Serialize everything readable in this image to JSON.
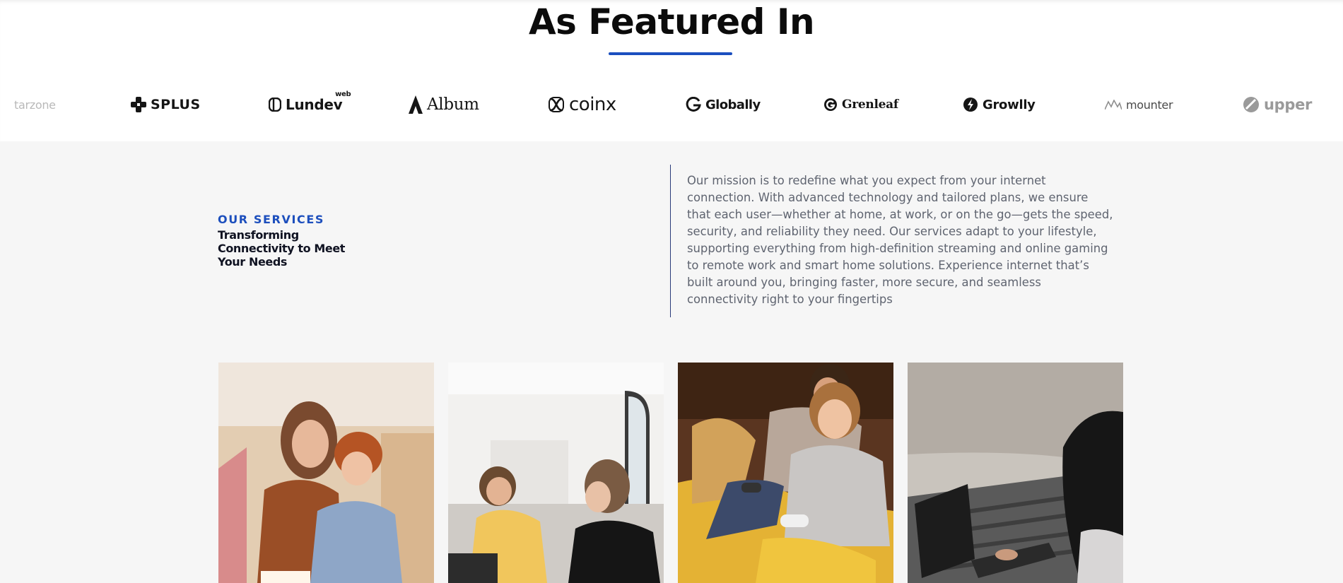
{
  "featured": {
    "title": "As Featured In",
    "accent_color": "#1b4fbf",
    "logos": [
      {
        "name": "tarzone",
        "text": "tarzone",
        "icon": "none"
      },
      {
        "name": "splus",
        "text": "SPLUS",
        "icon": "splus-icon"
      },
      {
        "name": "lundev",
        "text": "Lundev",
        "superscript": "web",
        "icon": "lundev-icon"
      },
      {
        "name": "album",
        "text": "Album",
        "icon": "album-icon"
      },
      {
        "name": "coinx",
        "text": "coinx",
        "icon": "coinx-icon"
      },
      {
        "name": "globally",
        "text": "Globally",
        "icon": "globally-icon"
      },
      {
        "name": "grenleaf",
        "text": "Grenleaf",
        "icon": "grenleaf-icon"
      },
      {
        "name": "growlly",
        "text": "Growlly",
        "icon": "growlly-icon"
      },
      {
        "name": "mounter",
        "text": "mounter",
        "icon": "mounter-icon"
      },
      {
        "name": "upper",
        "text": "upper",
        "icon": "upper-icon"
      }
    ]
  },
  "services": {
    "label": "OUR SERVICES",
    "title": "Transforming Connectivity to Meet Your Needs",
    "label_color": "#1d4fbd",
    "mission": "Our mission is to redefine what you expect from your internet connection. With advanced technology and tailored plans, we ensure that each user—whether at home, at work, or on the go—gets the speed, security, and reliability they need. Our services adapt to your lifestyle, supporting everything from high-definition streaming and online gaming to remote work and smart home solutions. Experience internet that’s built around you, bringing faster, more secure, and seamless connectivity right to your fingertips"
  },
  "photos": [
    {
      "name": "mother-and-son-with-tablet",
      "icon": "photo"
    },
    {
      "name": "friends-laughing-at-laptop",
      "icon": "photo"
    },
    {
      "name": "couple-playing-video-games",
      "icon": "photo"
    },
    {
      "name": "woman-working-on-laptop-outdoors",
      "icon": "photo"
    }
  ]
}
